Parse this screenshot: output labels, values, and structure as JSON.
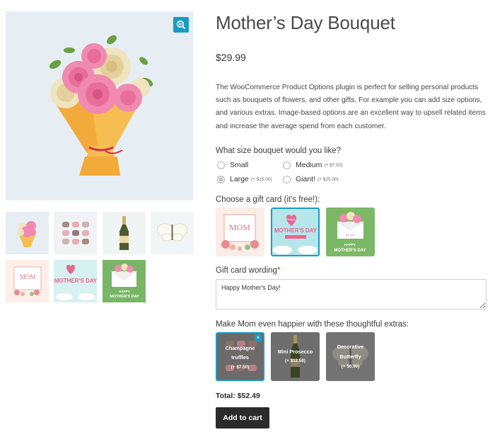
{
  "product": {
    "title": "Mother’s Day Bouquet",
    "price": "$29.99",
    "description": "The WooCommerce Product Options plugin is perfect for selling personal products such as bouquets of flowers, and other gifts. For example you can add size options, and various extras. Image-based options are an excellent way to upsell related items and increase the average spend from each customer."
  },
  "size": {
    "label": "What size bouquet would you like?",
    "options": [
      {
        "name": "Small",
        "extra": ""
      },
      {
        "name": "Medium",
        "extra": "(+ $7.50)"
      },
      {
        "name": "Large",
        "extra": "(+ $15.00)",
        "selected": true
      },
      {
        "name": "Giant!",
        "extra": "(+ $25.00)"
      }
    ]
  },
  "gift_card": {
    "label": "Choose a gift card (it's free!):",
    "cards": [
      {
        "text_1": "MOM",
        "text_2": "",
        "selected": false
      },
      {
        "text_1": "MOTHER'S DAY",
        "text_2": "happy",
        "selected": true
      },
      {
        "text_1": "HAPPY",
        "text_2": "MOTHER'S DAY",
        "text_3": "for you",
        "selected": false
      }
    ]
  },
  "wording": {
    "label": "Gift card wording",
    "required_mark": "*",
    "value": "Happy Mother's Day!"
  },
  "extras": {
    "label": "Make Mom even happier with these thoughtful extras:",
    "items": [
      {
        "name_1": "Champagne",
        "name_2": "truffles",
        "price": "(+ $7.50)",
        "selected": true
      },
      {
        "name_1": "Mini Prosecco",
        "name_2": "",
        "price": "(+ $12.50)",
        "selected": false
      },
      {
        "name_1": "Decorative",
        "name_2": "Butterfly",
        "price": "(+ $6.99)",
        "selected": false
      }
    ],
    "remove_glyph": "×"
  },
  "total": "Total: $52.49",
  "add_to_cart": "Add to cart",
  "thumb_text": {
    "mom": "MOM",
    "mothers_day": "MOTHER'S DAY",
    "happy": "HAPPY",
    "for_you": "for you"
  },
  "colors": {
    "accent": "#1a9bc4",
    "button_bg": "#2b2b2b",
    "rose": "#f07aa2",
    "cream_rose": "#efe3c0",
    "wrap": "#f4b646"
  },
  "icons": {
    "zoom": "zoom-in-icon"
  }
}
